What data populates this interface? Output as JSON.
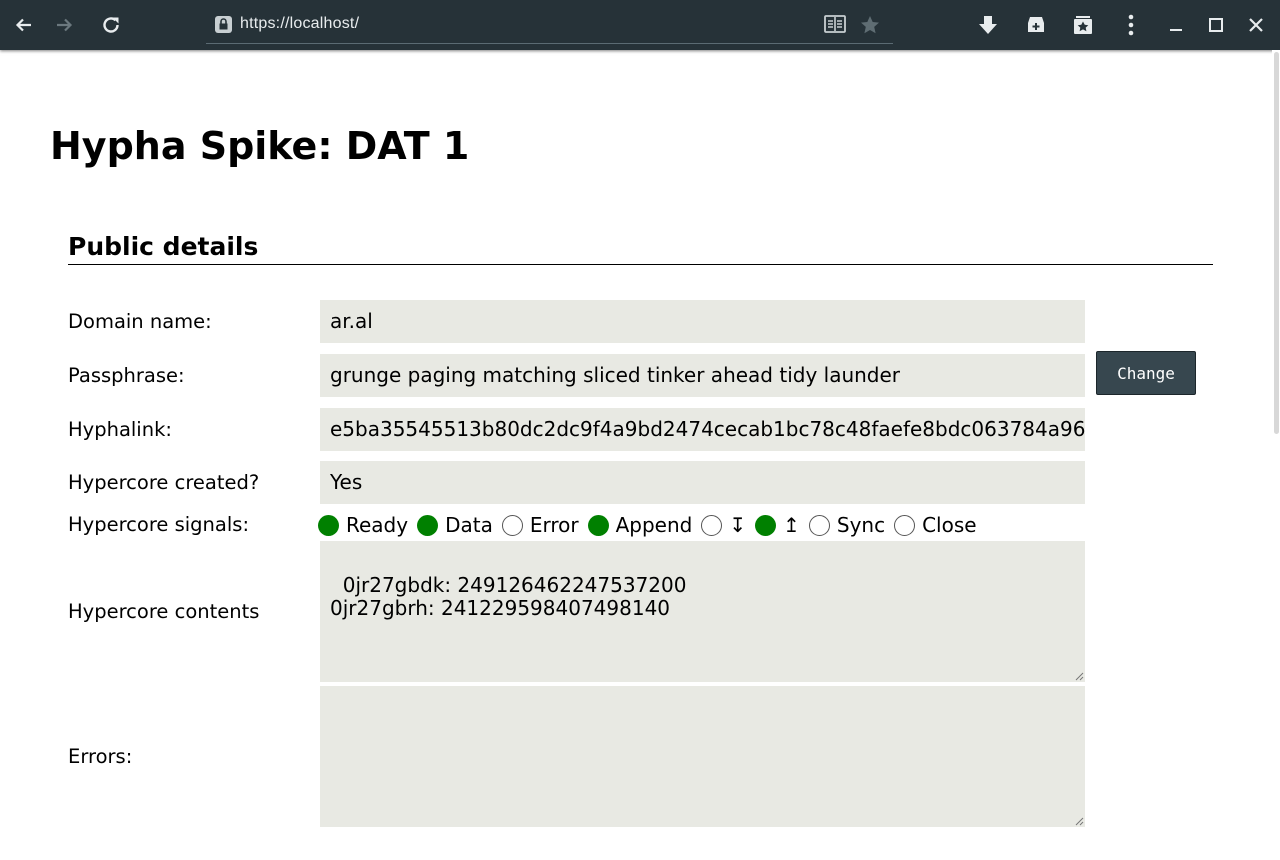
{
  "browser": {
    "url": "https://localhost/"
  },
  "page": {
    "title": "Hypha Spike: DAT 1",
    "section_heading": "Public details"
  },
  "fields": {
    "domain": {
      "label": "Domain name:",
      "value": "ar.al"
    },
    "passphrase": {
      "label": "Passphrase:",
      "value": "grunge paging matching sliced tinker ahead tidy launder"
    },
    "hyphalink": {
      "label": "Hyphalink:",
      "value": "e5ba35545513b80dc2dc9f4a9bd2474cecab1bc78c48faefe8bdc063784a96"
    },
    "created": {
      "label": "Hypercore created?",
      "value": "Yes"
    },
    "signals": {
      "label": "Hypercore signals:",
      "items": [
        {
          "label": "Ready",
          "state": "on"
        },
        {
          "label": "Data",
          "state": "on"
        },
        {
          "label": "Error",
          "state": "off"
        },
        {
          "label": "Append",
          "state": "on"
        },
        {
          "label": "↧",
          "state": "off"
        },
        {
          "label": "↥",
          "state": "on"
        },
        {
          "label": "Sync",
          "state": "off"
        },
        {
          "label": "Close",
          "state": "off"
        }
      ]
    },
    "contents": {
      "label": "Hypercore contents",
      "value": "0jr27gbdk: 249126462247537200\n0jr27gbrh: 241229598407498140"
    },
    "errors": {
      "label": "Errors:",
      "value": ""
    }
  },
  "buttons": {
    "change": "Change"
  },
  "colors": {
    "toolbar": "#263238",
    "field_bg": "#e8e9e3",
    "signal_on": "#008000",
    "button_bg": "#37474f"
  }
}
